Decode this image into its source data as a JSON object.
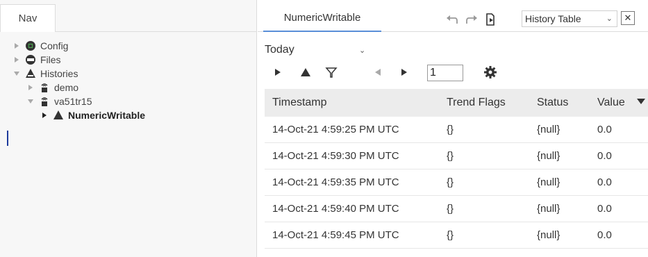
{
  "nav": {
    "tab_label": "Nav",
    "tree": [
      {
        "label": "Config",
        "icon": "config-icon",
        "caret": "collapsed"
      },
      {
        "label": "Files",
        "icon": "files-icon",
        "caret": "collapsed"
      },
      {
        "label": "Histories",
        "icon": "histories-icon",
        "caret": "expanded"
      },
      {
        "label": "demo",
        "icon": "device-icon",
        "caret": "collapsed"
      },
      {
        "label": "va51tr15",
        "icon": "device-icon",
        "caret": "expanded"
      },
      {
        "label": "NumericWritable",
        "icon": "history-icon",
        "caret": "collapsed",
        "selected": true
      }
    ]
  },
  "content": {
    "tab_label": "NumericWritable",
    "view_select": "History Table",
    "time_range": "Today",
    "page": "1",
    "columns": [
      "Timestamp",
      "Trend Flags",
      "Status",
      "Value"
    ],
    "rows": [
      [
        "14-Oct-21 4:59:25 PM UTC",
        "{}",
        "{null}",
        "0.0"
      ],
      [
        "14-Oct-21 4:59:30 PM UTC",
        "{}",
        "{null}",
        "0.0"
      ],
      [
        "14-Oct-21 4:59:35 PM UTC",
        "{}",
        "{null}",
        "0.0"
      ],
      [
        "14-Oct-21 4:59:40 PM UTC",
        "{}",
        "{null}",
        "0.0"
      ],
      [
        "14-Oct-21 4:59:45 PM UTC",
        "{}",
        "{null}",
        "0.0"
      ]
    ]
  },
  "colors": {
    "accent": "#5a8ed8",
    "selection": "#1d3b9c",
    "header_bg": "#ececec"
  }
}
